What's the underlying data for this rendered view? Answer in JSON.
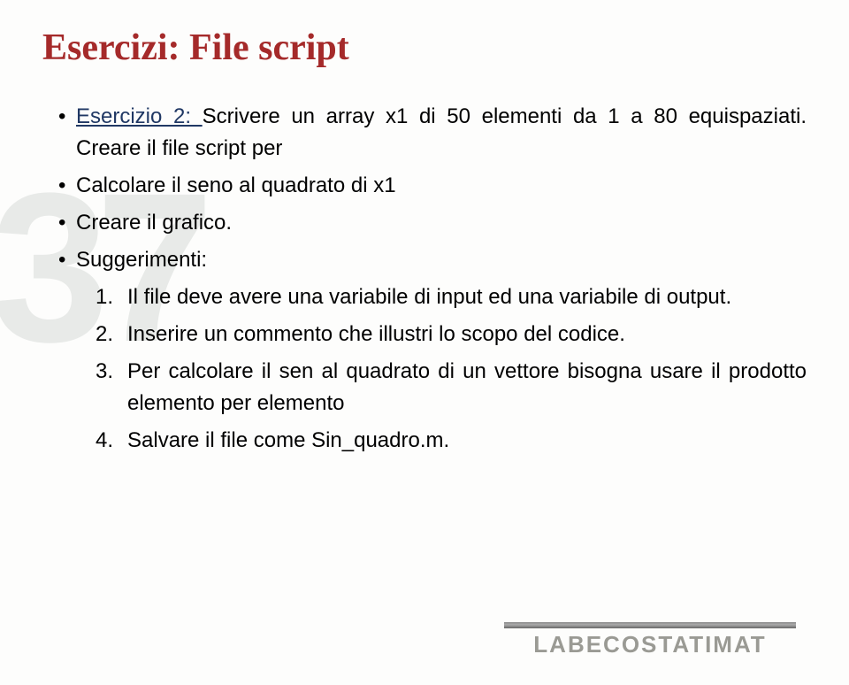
{
  "title": "Esercizi: File script",
  "bullets": {
    "ex_label": "Esercizio 2: ",
    "ex_text": "Scrivere un array x1 di 50 elementi da 1 a 80 equispaziati. Creare il file script per",
    "b2": "Calcolare il seno al quadrato di x1",
    "b3": "Creare il grafico.",
    "b4": "Suggerimenti:"
  },
  "numbered": {
    "n1": "Il file deve avere una variabile di input ed una variabile di output.",
    "n2": "Inserire un commento che illustri lo scopo del codice.",
    "n3": "Per calcolare il sen al quadrato di un vettore bisogna usare  il prodotto elemento per elemento",
    "n4": "Salvare il file come Sin_quadro.m."
  },
  "nums": {
    "l1": "1.",
    "l2": "2.",
    "l3": "3.",
    "l4": "4."
  },
  "watermark": "37",
  "logo_text": "LABECOSTATIMAT"
}
